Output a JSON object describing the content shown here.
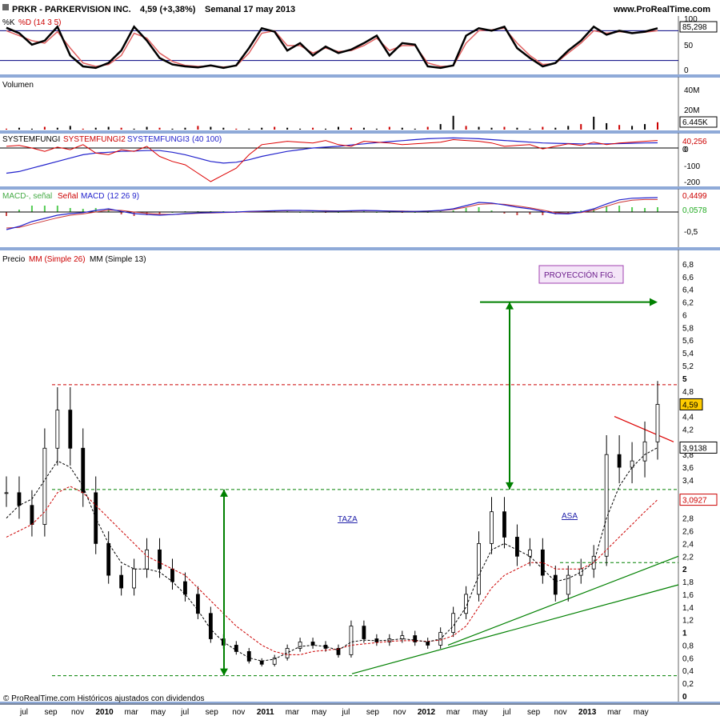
{
  "header": {
    "title": "PRKR - PARKERVISION INC.",
    "quote": "4,59 (+3,38%)",
    "period": "Semanal  17 may 2013",
    "site": "www.ProRealTime.com"
  },
  "footer": {
    "copyright": "© ProRealTime.com Históricos ajustados con dividendos"
  },
  "colors": {
    "green_line": "#008000",
    "red_dash": "#cc0000",
    "black_dash": "#000000",
    "blue": "#2222cc",
    "panel_sep": "#8faad8"
  },
  "x_axis": {
    "ticks": [
      {
        "label": "jul",
        "t": 0
      },
      {
        "label": "sep",
        "t": 2
      },
      {
        "label": "nov",
        "t": 4
      },
      {
        "label": "2010",
        "t": 6,
        "bold": true
      },
      {
        "label": "mar",
        "t": 8
      },
      {
        "label": "may",
        "t": 10
      },
      {
        "label": "jul",
        "t": 12
      },
      {
        "label": "sep",
        "t": 14
      },
      {
        "label": "nov",
        "t": 16
      },
      {
        "label": "2011",
        "t": 18,
        "bold": true
      },
      {
        "label": "mar",
        "t": 20
      },
      {
        "label": "may",
        "t": 22
      },
      {
        "label": "jul",
        "t": 24
      },
      {
        "label": "sep",
        "t": 26
      },
      {
        "label": "nov",
        "t": 28
      },
      {
        "label": "2012",
        "t": 30,
        "bold": true
      },
      {
        "label": "mar",
        "t": 32
      },
      {
        "label": "may",
        "t": 34
      },
      {
        "label": "jul",
        "t": 36
      },
      {
        "label": "sep",
        "t": 38
      },
      {
        "label": "nov",
        "t": 40
      },
      {
        "label": "2013",
        "t": 42,
        "bold": true
      },
      {
        "label": "mar",
        "t": 44
      },
      {
        "label": "may",
        "t": 46
      }
    ]
  },
  "panels": {
    "stoch": {
      "title_k": "%K",
      "title_d": "%D",
      "params": "(14 3 5)",
      "ticks": [
        "100",
        "50",
        "0"
      ],
      "value": "85,298",
      "k": [
        86,
        75,
        52,
        60,
        88,
        30,
        8,
        5,
        15,
        40,
        88,
        60,
        25,
        12,
        8,
        6,
        10,
        5,
        10,
        45,
        85,
        78,
        40,
        55,
        30,
        48,
        35,
        42,
        55,
        70,
        30,
        55,
        52,
        8,
        5,
        10,
        70,
        85,
        80,
        88,
        45,
        25,
        8,
        15,
        40,
        60,
        88,
        72,
        80,
        75,
        78,
        85
      ],
      "d": [
        80,
        70,
        60,
        55,
        78,
        45,
        15,
        8,
        12,
        30,
        75,
        65,
        35,
        18,
        10,
        8,
        9,
        7,
        9,
        35,
        75,
        80,
        50,
        50,
        35,
        45,
        38,
        40,
        50,
        65,
        40,
        50,
        50,
        15,
        8,
        9,
        55,
        80,
        82,
        85,
        55,
        30,
        12,
        14,
        35,
        55,
        80,
        75,
        78,
        76,
        77,
        80
      ]
    },
    "volume": {
      "title": "Volumen",
      "ticks": [
        "40M",
        "20M"
      ],
      "value": "6.445K",
      "values": [
        1,
        2,
        1,
        3,
        2,
        4,
        1,
        2,
        3,
        2,
        1,
        3,
        2,
        1,
        2,
        4,
        3,
        2,
        1,
        1,
        2,
        3,
        2,
        1,
        2,
        1,
        3,
        2,
        2,
        1,
        3,
        2,
        1,
        3,
        6,
        15,
        4,
        3,
        2,
        3,
        2,
        1,
        3,
        2,
        4,
        6,
        14,
        7,
        5,
        4,
        6,
        8
      ]
    },
    "system": {
      "title_1": "SYSTEMFUNGI",
      "title_2": "SYSTEMFUNGI2",
      "title_3": "SYSTEMFUNGI3",
      "params": "(40 100)",
      "ticks": [
        "0",
        "-100",
        "-200"
      ],
      "value_1": "40,256",
      "value_2": "0",
      "red": [
        10,
        15,
        0,
        -20,
        5,
        -10,
        20,
        -30,
        -40,
        -10,
        -20,
        10,
        -50,
        -80,
        -100,
        -150,
        -200,
        -160,
        -120,
        -40,
        20,
        30,
        40,
        35,
        30,
        45,
        20,
        10,
        40,
        35,
        30,
        20,
        25,
        30,
        35,
        50,
        45,
        40,
        30,
        10,
        15,
        20,
        -5,
        10,
        25,
        15,
        35,
        20,
        30,
        35,
        40,
        45
      ],
      "blue": [
        -150,
        -140,
        -120,
        -100,
        -80,
        -60,
        -40,
        -30,
        -25,
        -20,
        -18,
        -15,
        -15,
        -25,
        -40,
        -60,
        -80,
        -90,
        -85,
        -70,
        -50,
        -35,
        -20,
        -10,
        0,
        5,
        10,
        18,
        25,
        32,
        38,
        44,
        50,
        55,
        58,
        60,
        58,
        55,
        50,
        45,
        40,
        35,
        30,
        28,
        26,
        25,
        24,
        25,
        26,
        28,
        30,
        31
      ]
    },
    "macd": {
      "title_1": "MACD-, señal",
      "title_2": "Señal",
      "title_3": "MACD",
      "params": "(12 26 9)",
      "ticks": [
        "-0,5"
      ],
      "value_1": "0,4499",
      "value_2": "0,0578",
      "macd": [
        -0.55,
        -0.45,
        -0.3,
        -0.2,
        -0.1,
        -0.05,
        -0.02,
        0.05,
        0.1,
        0.02,
        -0.05,
        -0.08,
        -0.1,
        -0.08,
        -0.05,
        -0.03,
        -0.02,
        -0.01,
        0,
        0.02,
        0.03,
        0.04,
        0.05,
        0.05,
        0.04,
        0.03,
        0.03,
        0.04,
        0.05,
        0.04,
        0.03,
        0.02,
        0.02,
        0.03,
        0.05,
        0.1,
        0.2,
        0.3,
        0.28,
        0.22,
        0.15,
        0.1,
        0.02,
        -0.05,
        -0.06,
        0,
        0.1,
        0.25,
        0.38,
        0.43,
        0.44,
        0.45
      ],
      "signal": [
        -0.5,
        -0.48,
        -0.38,
        -0.28,
        -0.18,
        -0.1,
        -0.06,
        0,
        0.06,
        0.05,
        0.0,
        -0.04,
        -0.07,
        -0.08,
        -0.06,
        -0.04,
        -0.03,
        -0.02,
        -0.01,
        0.01,
        0.02,
        0.03,
        0.04,
        0.05,
        0.04,
        0.04,
        0.03,
        0.03,
        0.04,
        0.04,
        0.03,
        0.03,
        0.02,
        0.03,
        0.04,
        0.08,
        0.15,
        0.24,
        0.26,
        0.24,
        0.19,
        0.13,
        0.06,
        -0.02,
        -0.04,
        -0.02,
        0.06,
        0.18,
        0.3,
        0.37,
        0.39,
        0.39
      ]
    },
    "price": {
      "title_1": "Precio",
      "title_2": "MM (Simple 26)",
      "title_3": "MM (Simple 13)",
      "ticks": [
        "6,8",
        "6,6",
        "6,4",
        "6,2",
        "6",
        "5,8",
        "5,6",
        "5,4",
        "5,2",
        "5",
        "4,8",
        "4,4",
        "4,2",
        "3,8",
        "3,6",
        "3,4",
        "2,8",
        "2,6",
        "2,4",
        "2,2",
        "2",
        "1,8",
        "1,6",
        "1,4",
        "1,2",
        "1",
        "0,8",
        "0,6",
        "0,4",
        "0,2",
        "0"
      ],
      "last": "4,59",
      "mm13": "3,9138",
      "mm26": "3,0927",
      "label_taza": "TAZA",
      "label_asa": "ASA",
      "label_proj": "PROYECCIÓN FIG.",
      "ylim": [
        0,
        6.9
      ]
    }
  },
  "chart_data": {
    "type": "line",
    "title": "PRKR - PARKERVISION INC.",
    "x": [
      "jul",
      "sep",
      "nov",
      "2010",
      "mar",
      "may",
      "jul",
      "sep",
      "nov",
      "2011",
      "mar",
      "may",
      "jul",
      "sep",
      "nov",
      "2012",
      "mar",
      "may",
      "jul",
      "sep",
      "nov",
      "2013",
      "mar",
      "may"
    ],
    "series": [
      {
        "name": "Precio",
        "values": [
          3.2,
          3.0,
          2.7,
          3.9,
          4.5,
          3.9,
          3.2,
          2.4,
          1.9,
          1.7,
          2.0,
          2.3,
          2.0,
          1.8,
          1.6,
          1.3,
          0.9,
          0.8,
          0.7,
          0.55,
          0.5,
          0.6,
          0.75,
          0.85,
          0.8,
          0.75,
          0.65,
          1.1,
          0.9,
          0.85,
          0.9,
          0.95,
          0.85,
          0.8,
          1.0,
          1.3,
          1.6,
          2.4,
          2.9,
          2.5,
          2.2,
          2.3,
          1.9,
          1.6,
          1.9,
          2.0,
          2.2,
          3.8,
          3.6,
          3.7,
          4.0,
          4.59
        ]
      },
      {
        "name": "MM (Simple 26)",
        "values": [
          2.5,
          2.6,
          2.7,
          2.9,
          3.2,
          3.3,
          3.2,
          3.0,
          2.8,
          2.6,
          2.4,
          2.2,
          2.1,
          2.0,
          1.9,
          1.7,
          1.5,
          1.3,
          1.1,
          0.95,
          0.8,
          0.7,
          0.65,
          0.65,
          0.7,
          0.72,
          0.74,
          0.8,
          0.82,
          0.84,
          0.86,
          0.87,
          0.87,
          0.86,
          0.88,
          0.95,
          1.1,
          1.4,
          1.7,
          1.9,
          2.0,
          2.1,
          2.1,
          2.0,
          2.0,
          2.0,
          2.1,
          2.3,
          2.5,
          2.7,
          2.9,
          3.09
        ]
      },
      {
        "name": "MM (Simple 13)",
        "values": [
          2.8,
          3.0,
          3.1,
          3.4,
          3.7,
          3.6,
          3.3,
          2.8,
          2.4,
          2.1,
          2.0,
          2.0,
          1.95,
          1.8,
          1.6,
          1.35,
          1.05,
          0.85,
          0.72,
          0.6,
          0.55,
          0.58,
          0.68,
          0.78,
          0.8,
          0.78,
          0.72,
          0.85,
          0.88,
          0.87,
          0.88,
          0.9,
          0.88,
          0.85,
          0.9,
          1.1,
          1.4,
          1.9,
          2.3,
          2.4,
          2.3,
          2.2,
          2.0,
          1.8,
          1.85,
          1.95,
          2.1,
          2.8,
          3.3,
          3.6,
          3.8,
          3.91
        ]
      }
    ],
    "levels": {
      "resistance": 4.9,
      "neckline": 3.25,
      "low": 0.32,
      "target": 6.2
    },
    "ylim": [
      0,
      6.9
    ],
    "grid": false
  }
}
